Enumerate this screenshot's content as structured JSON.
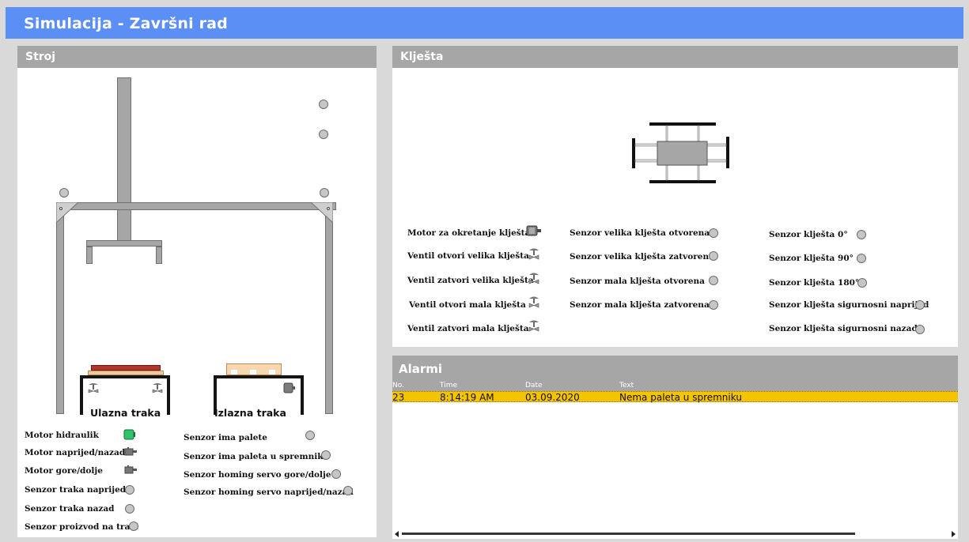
{
  "header": {
    "title": "Simulacija - Završni rad"
  },
  "stroj": {
    "title": "Stroj",
    "belt_in_label": "Ulazna traka",
    "belt_out_label": "Izlazna traka",
    "left_items": [
      {
        "label": "Motor hidraulik",
        "icon": "hydraulic-motor-icon",
        "state_color": "#2fc46b"
      },
      {
        "label": "Motor naprijed/nazad",
        "icon": "motor-icon"
      },
      {
        "label": "Motor gore/dolje",
        "icon": "motor-icon"
      },
      {
        "label": "Senzor traka naprijed",
        "icon": "sensor-led"
      },
      {
        "label": "Senzor traka nazad",
        "icon": "sensor-led"
      },
      {
        "label": "Senzor proizvod na traci",
        "icon": "sensor-led"
      }
    ],
    "right_items": [
      {
        "label": "Senzor ima palete"
      },
      {
        "label": "Senzor ima paleta u spremniku"
      },
      {
        "label": "Senzor homing servo gore/dolje"
      },
      {
        "label": "Senzor homing servo naprijed/nazad"
      }
    ]
  },
  "klijesta": {
    "title": "Klješta",
    "col1": [
      {
        "label": "Motor za okretanje klješta",
        "icon": "motor-icon"
      },
      {
        "label": "Ventil otvori velika klješta",
        "icon": "valve-icon"
      },
      {
        "label": "Ventil zatvori velika klješta",
        "icon": "valve-icon"
      },
      {
        "label": "Ventil otvori mala klješta",
        "icon": "valve-icon"
      },
      {
        "label": "Ventil zatvori mala klješta",
        "icon": "valve-icon"
      }
    ],
    "col2": [
      {
        "label": "Senzor velika klješta otvorena"
      },
      {
        "label": "Senzor velika klješta zatvorena"
      },
      {
        "label": "Senzor mala klješta otvorena"
      },
      {
        "label": "Senzor mala klješta zatvorena"
      }
    ],
    "col3": [
      {
        "label": "Senzor klješta 0°"
      },
      {
        "label": "Senzor klješta 90°"
      },
      {
        "label": "Senzor klješta 180°"
      },
      {
        "label": "Senzor klješta sigurnosni naprijed"
      },
      {
        "label": "Senzor klješta sigurnosni nazad"
      }
    ]
  },
  "alarms": {
    "title": "Alarmi",
    "columns": [
      "No.",
      "Time",
      "Date",
      "Text"
    ],
    "rows": [
      {
        "no": "23",
        "time": "8:14:19 AM",
        "date": "03.09.2020",
        "text": "Nema paleta u spremniku"
      }
    ],
    "row_color": "#f5c400"
  },
  "colors": {
    "header": "#5b8ff5",
    "panel_header": "#a6a6a6",
    "led_off": "#c6c6c6"
  }
}
